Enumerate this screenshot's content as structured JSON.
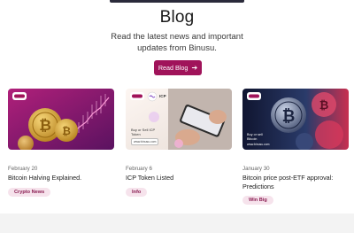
{
  "header": {
    "title": "Blog",
    "subtitle": "Read the latest news and important updates from Binusu.",
    "read_button": "Read Blog"
  },
  "posts": [
    {
      "date": "February 20",
      "headline": "Bitcoin Halving Explained.",
      "tag": "Crypto News"
    },
    {
      "date": "February 6",
      "headline": "ICP Token Listed",
      "tag": "Info",
      "thumb_text": {
        "partner_logo": "ICP",
        "promo": "Buy or Sell ICP Token",
        "url": "www.binusu.com"
      }
    },
    {
      "date": "January 30",
      "headline": "Bitcoin price post-ETF approval: Predictions",
      "tag": "Win Big",
      "thumb_text": {
        "promo": "Buy or sell Bitcoin",
        "url": "www.binusu.com"
      }
    }
  ],
  "colors": {
    "accent": "#a0135a",
    "tag_bg": "#f6e3ec",
    "tag_text": "#8a1d52"
  }
}
